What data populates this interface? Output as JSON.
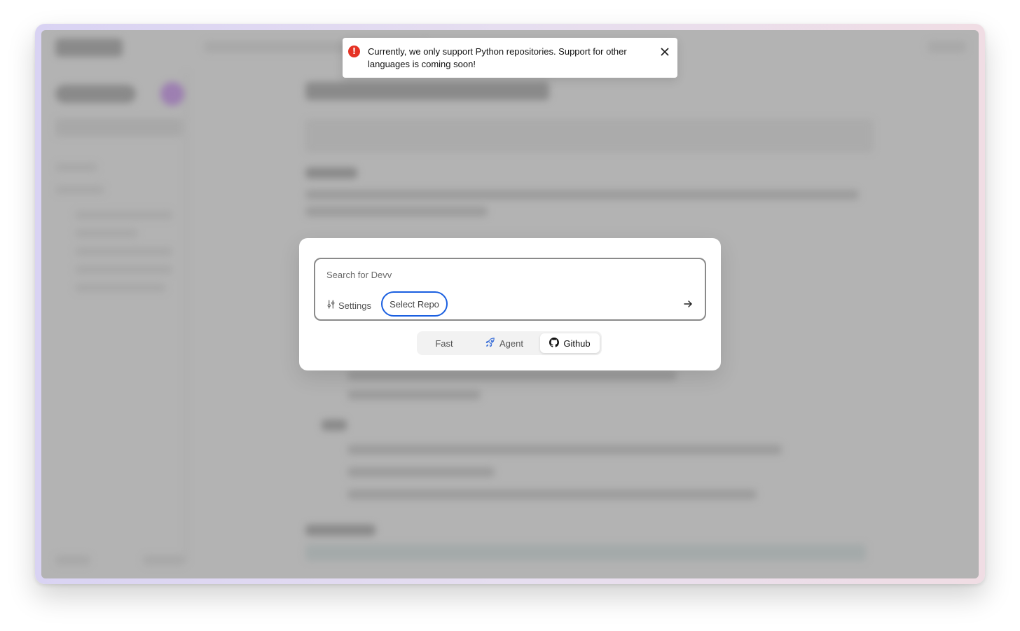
{
  "toast": {
    "message": "Currently, we only support Python repositories. Support for other languages is coming soon!",
    "icon": "error-icon",
    "close_icon": "close-icon",
    "accent": "#e53224"
  },
  "search": {
    "placeholder": "Search for Devv",
    "value": "",
    "settings_label": "Settings",
    "select_repo_label": "Select Repo",
    "submit_icon": "arrow-right-icon",
    "focus_color": "#1a5fe0"
  },
  "modes": [
    {
      "label": "Fast",
      "icon": "",
      "active": false
    },
    {
      "label": "Agent",
      "icon": "rocket-icon",
      "active": false
    },
    {
      "label": "Github",
      "icon": "github-icon",
      "active": true
    }
  ]
}
